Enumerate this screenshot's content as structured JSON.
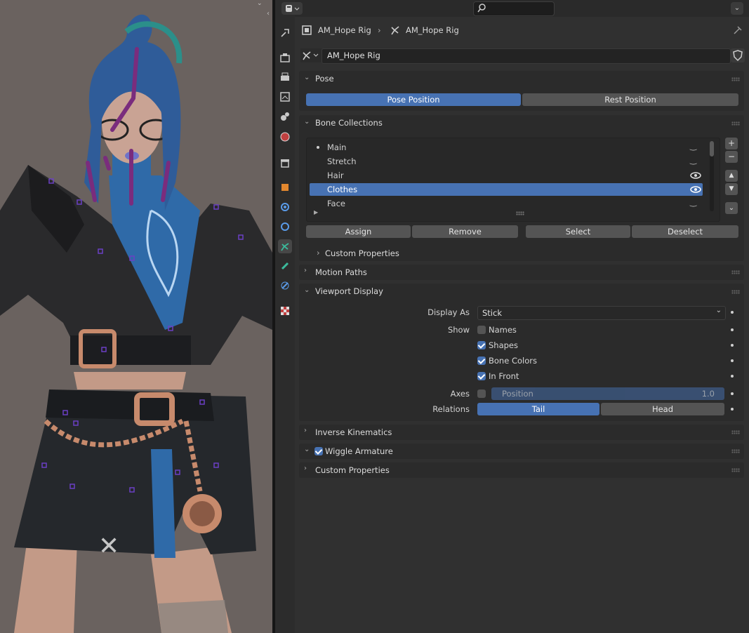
{
  "header": {
    "breadcrumb_object": "AM_Hope Rig",
    "breadcrumb_data": "AM_Hope Rig",
    "data_name": "AM_Hope Rig"
  },
  "pose_panel": {
    "title": "Pose",
    "pose_position": "Pose Position",
    "rest_position": "Rest Position",
    "active": "Pose Position"
  },
  "bone_collections": {
    "title": "Bone Collections",
    "items": [
      {
        "label": "Main",
        "visible": false,
        "active_dot": true
      },
      {
        "label": "Stretch",
        "visible": false
      },
      {
        "label": "Hair",
        "visible": true
      },
      {
        "label": "Clothes",
        "visible": true,
        "selected": true
      },
      {
        "label": "Face",
        "visible": false
      }
    ],
    "assign": "Assign",
    "remove": "Remove",
    "select": "Select",
    "deselect": "Deselect",
    "custom_properties": "Custom Properties"
  },
  "motion_paths": {
    "title": "Motion Paths"
  },
  "viewport_display": {
    "title": "Viewport Display",
    "display_as_label": "Display As",
    "display_as_value": "Stick",
    "show_label": "Show",
    "names": "Names",
    "shapes": "Shapes",
    "bone_colors": "Bone Colors",
    "in_front": "In Front",
    "names_checked": false,
    "shapes_checked": true,
    "bone_colors_checked": true,
    "in_front_checked": true,
    "axes_label": "Axes",
    "axes_checked": false,
    "position_label": "Position",
    "position_value": "1.0",
    "relations_label": "Relations",
    "tail": "Tail",
    "head": "Head",
    "relations_active": "Tail"
  },
  "inverse_kinematics": {
    "title": "Inverse Kinematics"
  },
  "wiggle_armature": {
    "title": "Wiggle Armature",
    "checked": true
  },
  "custom_properties": {
    "title": "Custom Properties"
  },
  "colors": {
    "accent": "#4772b3",
    "panel": "#2b2b2b",
    "background": "#303030",
    "tab_active_icon": "#3bbb9c"
  }
}
